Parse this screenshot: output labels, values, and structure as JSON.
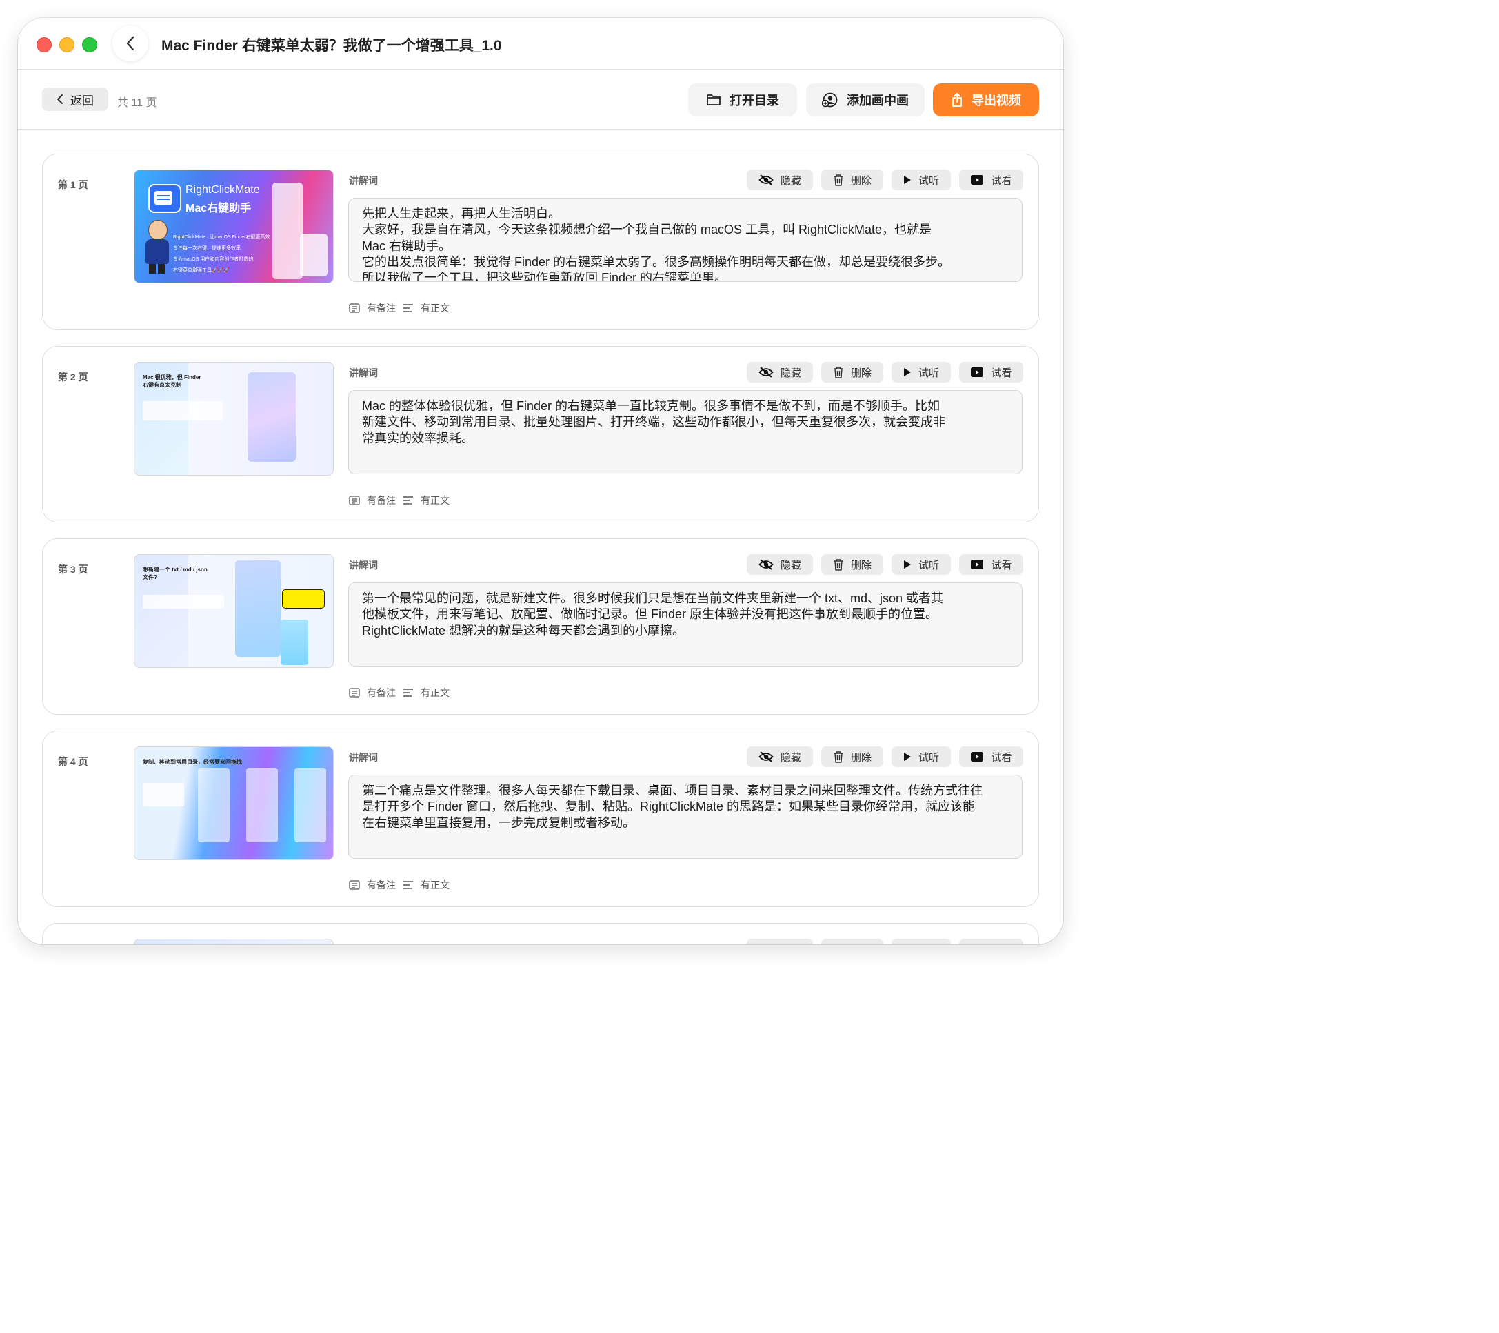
{
  "window": {
    "title": "Mac Finder 右键菜单太弱？我做了一个增强工具_1.0"
  },
  "toolbar": {
    "back_label": "返回",
    "page_count": "共 11 页",
    "open_dir_label": "打开目录",
    "pip_label": "添加画中画",
    "export_label": "导出视频",
    "export_color": "#ff8124"
  },
  "labels": {
    "script_label": "讲解词",
    "hide": "隐藏",
    "delete": "删除",
    "listen": "试听",
    "watch": "试看",
    "has_notes": "有备注",
    "has_body": "有正文"
  },
  "pages": [
    {
      "label": "第 1 页",
      "thumb": {
        "title_line1": "RightClickMate",
        "title_line2": "Mac右键助手",
        "body_lines": [
          "RightClickMate · 让macOS Finder右键更高效",
          "专注每一次右键，提速更多效率",
          "专为macOS 用户和内容创作者打造的",
          "右键菜单增强工具🚀🚀🚀"
        ]
      },
      "script": "先把人生走起来，再把人生活明白。\n大家好，我是自在清风，今天这条视频想介绍一个我自己做的 macOS 工具，叫 RightClickMate，也就是\nMac 右键助手。\n它的出发点很简单：我觉得 Finder 的右键菜单太弱了。很多高频操作明明每天都在做，却总是要绕很多步。\n所以我做了一个工具，把这些动作重新放回 Finder 的右键菜单里。"
    },
    {
      "label": "第 2 页",
      "thumb": {
        "title_line1": "Mac 很优雅，但 Finder",
        "title_line2": "右键有点太克制"
      },
      "script": "Mac 的整体体验很优雅，但 Finder 的右键菜单一直比较克制。很多事情不是做不到，而是不够顺手。比如\n新建文件、移动到常用目录、批量处理图片、打开终端，这些动作都很小，但每天重复很多次，就会变成非\n常真实的效率损耗。"
    },
    {
      "label": "第 3 页",
      "thumb": {
        "title_line1": "想新建一个 txt / md / json",
        "title_line2": "文件?"
      },
      "script": "第一个最常见的问题，就是新建文件。很多时候我们只是想在当前文件夹里新建一个 txt、md、json 或者其\n他模板文件，用来写笔记、放配置、做临时记录。但 Finder 原生体验并没有把这件事放到最顺手的位置。\nRightClickMate 想解决的就是这种每天都会遇到的小摩擦。"
    },
    {
      "label": "第 4 页",
      "thumb": {
        "title_line1": "复制、移动到常用目录，经常要来回拖拽",
        "title_line2": ""
      },
      "script": "第二个痛点是文件整理。很多人每天都在下载目录、桌面、项目目录、素材目录之间来回整理文件。传统方式往往\n是打开多个 Finder 窗口，然后拖拽、复制、粘贴。RightClickMate 的思路是：如果某些目录你经常用，就应该能\n在右键菜单里直接复用，一步完成复制或者移动。"
    }
  ]
}
